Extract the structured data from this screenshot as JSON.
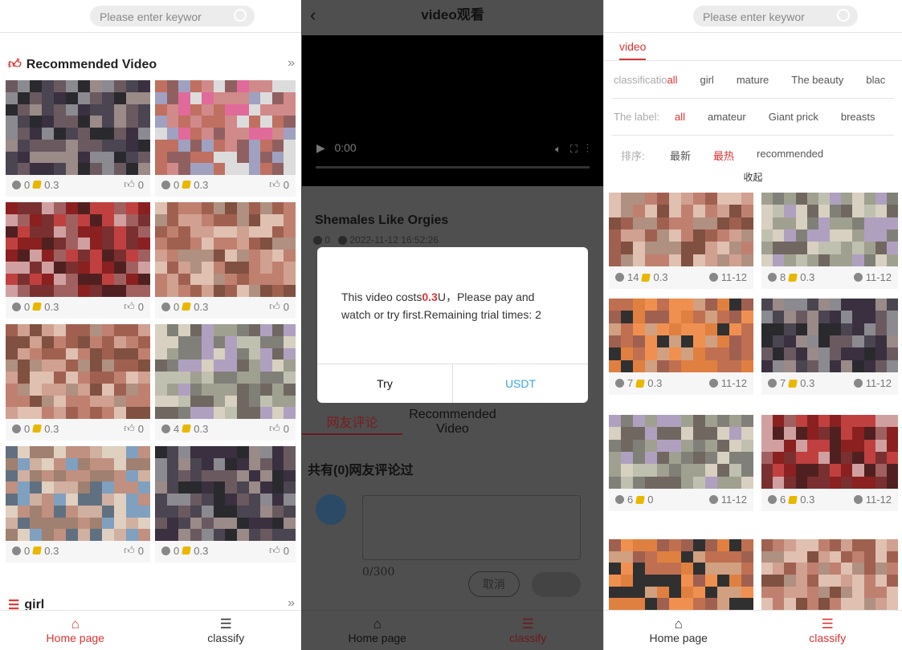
{
  "colors": {
    "accent": "#d33333",
    "link": "#3ba3e6",
    "coin": "#e8b800"
  },
  "left": {
    "search_placeholder": "Please enter keywor",
    "section_title": "Recommended Video",
    "section2_title": "girl",
    "cards": [
      {
        "plays": "0",
        "price": "0.3",
        "likes": "0",
        "tone": "dark"
      },
      {
        "plays": "0",
        "price": "0.3",
        "likes": "0",
        "tone": "pink"
      },
      {
        "plays": "0",
        "price": "0.3",
        "likes": "0",
        "tone": "red"
      },
      {
        "plays": "0",
        "price": "0.3",
        "likes": "0",
        "tone": "skin"
      },
      {
        "plays": "0",
        "price": "0.3",
        "likes": "0",
        "tone": "skin"
      },
      {
        "plays": "4",
        "price": "0.3",
        "likes": "0",
        "tone": "gray"
      },
      {
        "plays": "0",
        "price": "0.3",
        "likes": "0",
        "tone": "blue"
      },
      {
        "plays": "0",
        "price": "0.3",
        "likes": "0",
        "tone": "dark"
      }
    ],
    "nav": [
      {
        "label": "Home page",
        "active": true
      },
      {
        "label": "classify",
        "active": false
      }
    ]
  },
  "middle": {
    "header_title": "video观看",
    "player_time": "0:00",
    "video_title": "Shemales Like Orgies",
    "meta_views": "0",
    "meta_date": "2022-11-12 16:52:26",
    "modal": {
      "text_before": "This video costs",
      "price": "0.3",
      "text_after": "U，Please pay and watch or try first.Remaining trial times: 2",
      "try_label": "Try",
      "pay_label": "USDT"
    },
    "tabs": [
      "网友评论",
      "Recommended Video"
    ],
    "comment_heading": "共有(0)网友评论过",
    "char_count": "0/300",
    "cancel_label": "取消",
    "nav": [
      {
        "label": "Home page",
        "active": false
      },
      {
        "label": "classify",
        "active": true
      }
    ]
  },
  "right": {
    "search_placeholder": "Please enter keywor",
    "tab": "video",
    "classification": {
      "label": "classificatio",
      "options": [
        "all",
        "girl",
        "mature",
        "The beauty",
        "blac"
      ]
    },
    "labels": {
      "label": "The label:",
      "options": [
        "all",
        "amateur",
        "Giant prick",
        "breasts"
      ]
    },
    "sort": {
      "label": "排序:",
      "options": [
        "最新",
        "最热",
        "recommended"
      ],
      "active": 1
    },
    "collapse": "收起",
    "cards": [
      {
        "plays": "14",
        "price": "0.3",
        "date": "11-12",
        "tone": "skin"
      },
      {
        "plays": "8",
        "price": "0.3",
        "date": "11-12",
        "tone": "gray"
      },
      {
        "plays": "7",
        "price": "0.3",
        "date": "11-12",
        "tone": "orange"
      },
      {
        "plays": "7",
        "price": "0.3",
        "date": "11-12",
        "tone": "dark"
      },
      {
        "plays": "6",
        "price": "0",
        "date": "11-12",
        "tone": "gray"
      },
      {
        "plays": "6",
        "price": "0.3",
        "date": "11-12",
        "tone": "red"
      },
      {
        "plays": "",
        "price": "",
        "date": "",
        "tone": "orange"
      },
      {
        "plays": "",
        "price": "",
        "date": "",
        "tone": "skin"
      }
    ],
    "nav": [
      {
        "label": "Home page",
        "active": false
      },
      {
        "label": "classify",
        "active": true
      }
    ]
  }
}
